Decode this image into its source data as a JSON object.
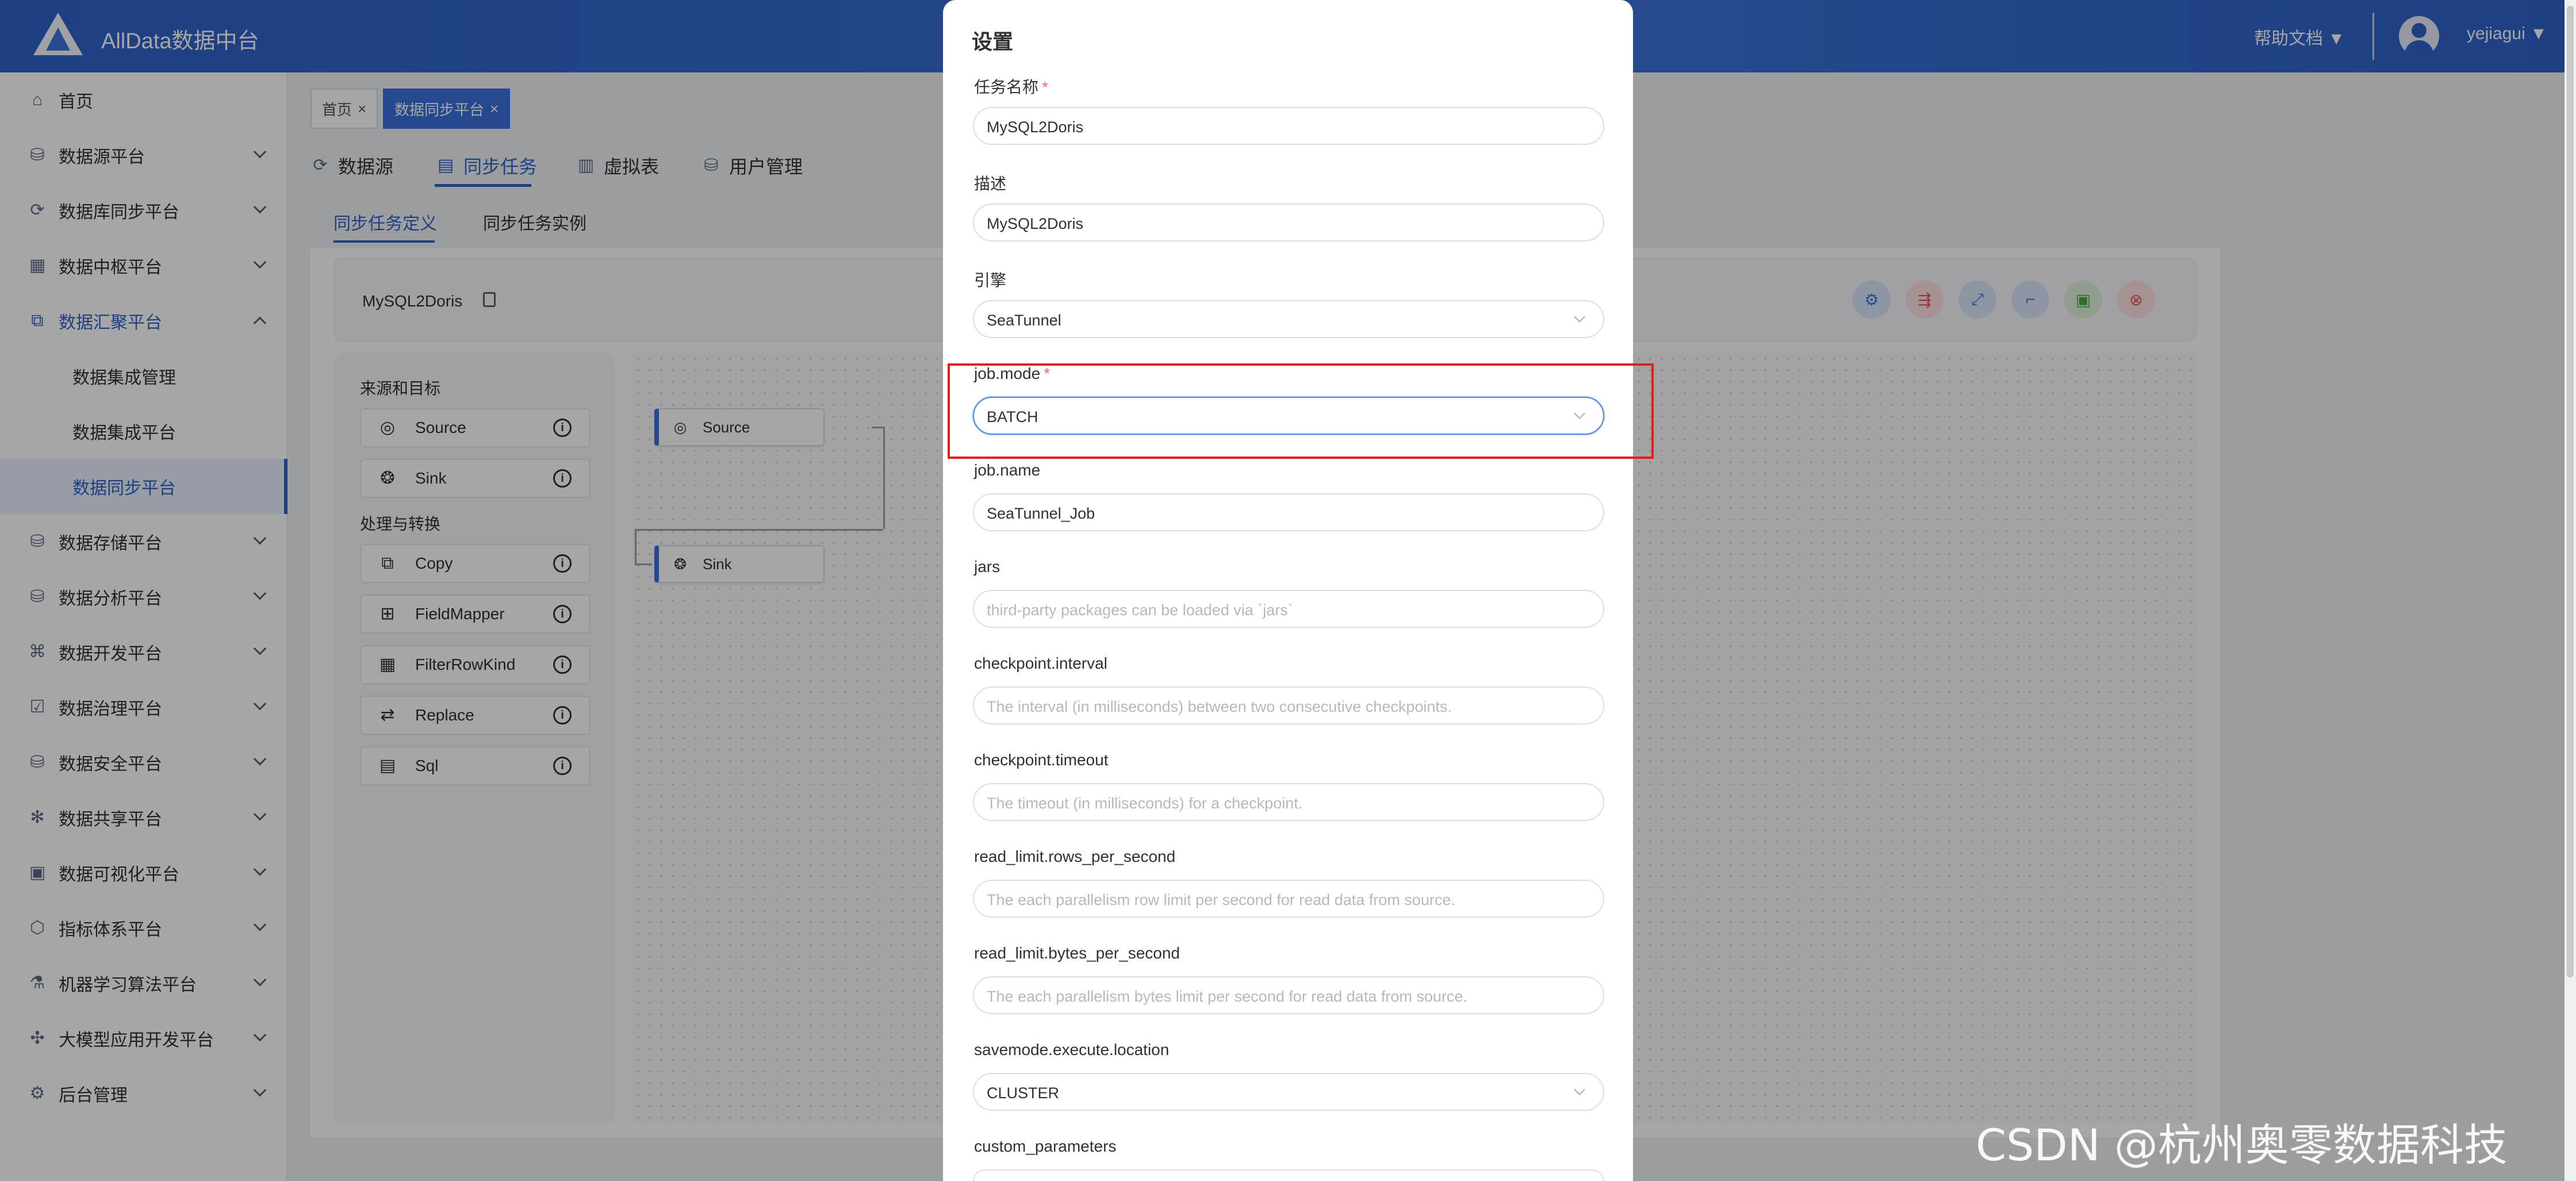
{
  "header": {
    "logo_text": "AllData数据中台",
    "help_docs": "帮助文档 ▼",
    "username": "yejiagui ▼"
  },
  "sidebar": {
    "items": [
      {
        "label": "首页",
        "icon": "home-icon"
      },
      {
        "label": "数据源平台",
        "icon": "database-icon"
      },
      {
        "label": "数据库同步平台",
        "icon": "sync-icon"
      },
      {
        "label": "数据中枢平台",
        "icon": "hub-icon"
      },
      {
        "label": "数据汇聚平台",
        "icon": "layers-icon"
      },
      {
        "label": "数据集成管理"
      },
      {
        "label": "数据集成平台"
      },
      {
        "label": "数据同步平台"
      },
      {
        "label": "数据存储平台",
        "icon": "storage-icon"
      },
      {
        "label": "数据分析平台",
        "icon": "analysis-icon"
      },
      {
        "label": "数据开发平台",
        "icon": "develop-icon"
      },
      {
        "label": "数据治理平台",
        "icon": "governance-icon"
      },
      {
        "label": "数据安全平台",
        "icon": "security-icon"
      },
      {
        "label": "数据共享平台",
        "icon": "share-icon"
      },
      {
        "label": "数据可视化平台",
        "icon": "visual-icon"
      },
      {
        "label": "指标体系平台",
        "icon": "metrics-icon"
      },
      {
        "label": "机器学习算法平台",
        "icon": "ml-icon"
      },
      {
        "label": "大模型应用开发平台",
        "icon": "llm-icon"
      },
      {
        "label": "后台管理",
        "icon": "admin-icon"
      }
    ]
  },
  "tags": [
    {
      "label": "首页",
      "close": "×"
    },
    {
      "label": "数据同步平台",
      "close": "×"
    }
  ],
  "topnav": [
    {
      "label": "数据源",
      "icon": "refresh-icon"
    },
    {
      "label": "同步任务",
      "icon": "document-icon"
    },
    {
      "label": "虚拟表",
      "icon": "table-icon"
    },
    {
      "label": "用户管理",
      "icon": "user-db-icon"
    }
  ],
  "subtabs": [
    "同步任务定义",
    "同步任务实例"
  ],
  "task": {
    "name": "MySQL2Doris"
  },
  "palette": {
    "group1": "来源和目标",
    "group2": "处理与转换",
    "items": [
      {
        "label": "Source",
        "icon": "source-icon"
      },
      {
        "label": "Sink",
        "icon": "sink-icon"
      },
      {
        "label": "Copy",
        "icon": "copy-icon"
      },
      {
        "label": "FieldMapper",
        "icon": "fieldmapper-icon"
      },
      {
        "label": "FilterRowKind",
        "icon": "filter-icon"
      },
      {
        "label": "Replace",
        "icon": "replace-icon"
      },
      {
        "label": "Sql",
        "icon": "sql-icon"
      }
    ],
    "info_glyph": "i"
  },
  "canvas": {
    "nodes": [
      {
        "label": "Source",
        "icon": "source-icon"
      },
      {
        "label": "Sink",
        "icon": "sink-icon"
      }
    ]
  },
  "modal": {
    "title": "设置",
    "required_mark": "*",
    "fields": [
      {
        "label": "任务名称",
        "value": "MySQL2Doris",
        "required": true
      },
      {
        "label": "描述",
        "value": "MySQL2Doris"
      },
      {
        "label": "引擎",
        "value": "SeaTunnel",
        "select": true
      },
      {
        "label": "job.mode",
        "value": "BATCH",
        "select": true,
        "required": true
      },
      {
        "label": "job.name",
        "value": "SeaTunnel_Job"
      },
      {
        "label": "jars",
        "placeholder": "third-party packages can be loaded via `jars`"
      },
      {
        "label": "checkpoint.interval",
        "placeholder": "The interval (in milliseconds) between two consecutive checkpoints."
      },
      {
        "label": "checkpoint.timeout",
        "placeholder": "The timeout (in milliseconds) for a checkpoint."
      },
      {
        "label": "read_limit.rows_per_second",
        "placeholder": "The each parallelism row limit per second for read data from source."
      },
      {
        "label": "read_limit.bytes_per_second",
        "placeholder": "The each parallelism bytes limit per second for read data from source."
      },
      {
        "label": "savemode.execute.location",
        "value": "CLUSTER",
        "select": true
      },
      {
        "label": "custom_parameters",
        "value": ""
      }
    ]
  },
  "colors": {
    "primary": "#2f62c8",
    "danger": "#e02020"
  },
  "watermark": "CSDN @杭州奥零数据科技"
}
